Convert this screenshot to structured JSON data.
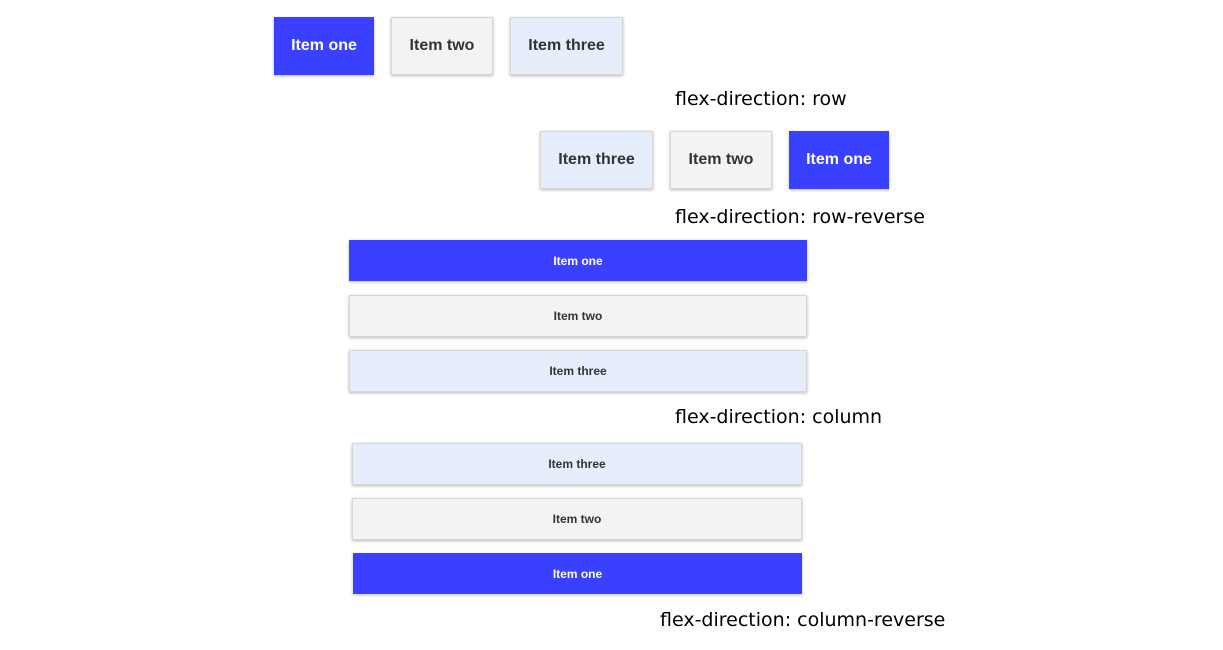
{
  "colors": {
    "item_one_bg": "#3a40ff",
    "item_two_bg": "#f2f3f3",
    "item_three_bg": "#e7eefb"
  },
  "items": {
    "one": "Item one",
    "two": "Item two",
    "three": "Item three"
  },
  "examples": [
    {
      "label": "flex-direction: row"
    },
    {
      "label": "flex-direction: row-reverse"
    },
    {
      "label": "flex-direction: column"
    },
    {
      "label": "flex-direction: column-reverse"
    }
  ]
}
